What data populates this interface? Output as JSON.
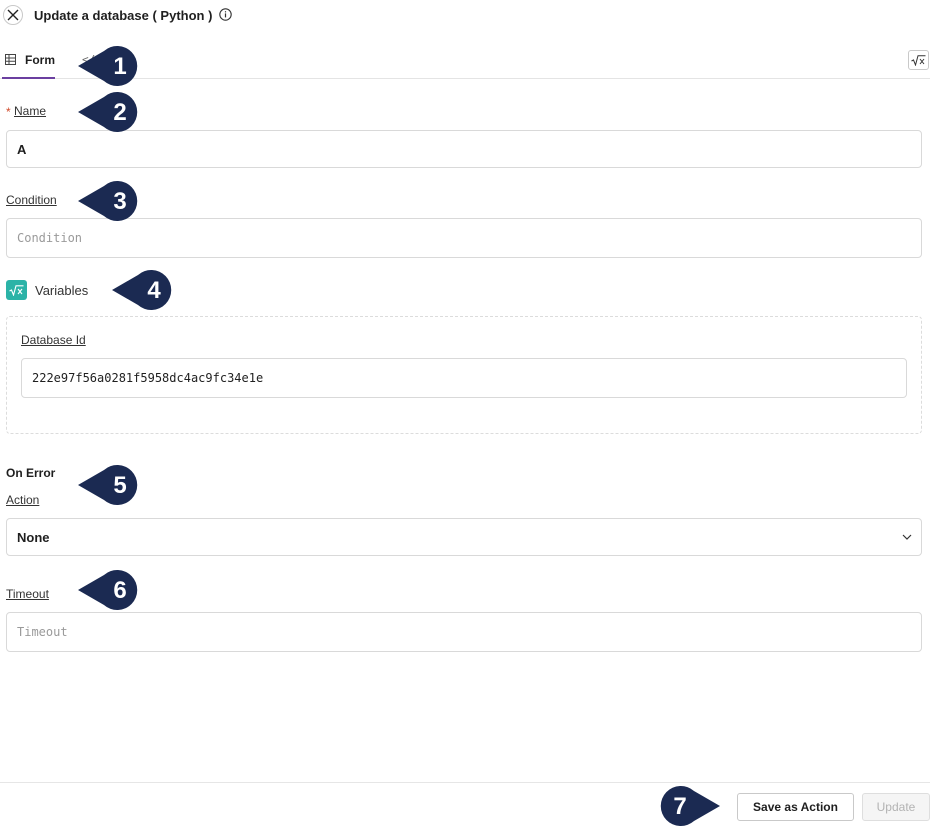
{
  "header": {
    "title": "Update a database ( Python )"
  },
  "tabs": {
    "form_label": "Form",
    "code_label": "</"
  },
  "fields": {
    "name": {
      "label": "Name",
      "required_mark": "*",
      "value": "A"
    },
    "condition": {
      "label": "Condition",
      "placeholder": "Condition"
    },
    "variables": {
      "label": "Variables"
    },
    "database_id": {
      "label": "Database Id",
      "value": "222e97f56a0281f5958dc4ac9fc34e1e"
    },
    "on_error": {
      "heading": "On Error",
      "action_label": "Action",
      "action_value": "None"
    },
    "timeout": {
      "label": "Timeout",
      "placeholder": "Timeout"
    }
  },
  "footer": {
    "save_label": "Save as Action",
    "update_label": "Update"
  },
  "markers": [
    "1",
    "2",
    "3",
    "4",
    "5",
    "6",
    "7"
  ],
  "colors": {
    "accent": "#6b3fa0",
    "variables_icon": "#2bb3a7",
    "marker": "#1b2a52",
    "required": "#d04a2a"
  },
  "icons": [
    "close-icon",
    "info-icon",
    "table-grid-icon",
    "code-icon",
    "sqrt-x-icon",
    "chevron-down-icon"
  ]
}
